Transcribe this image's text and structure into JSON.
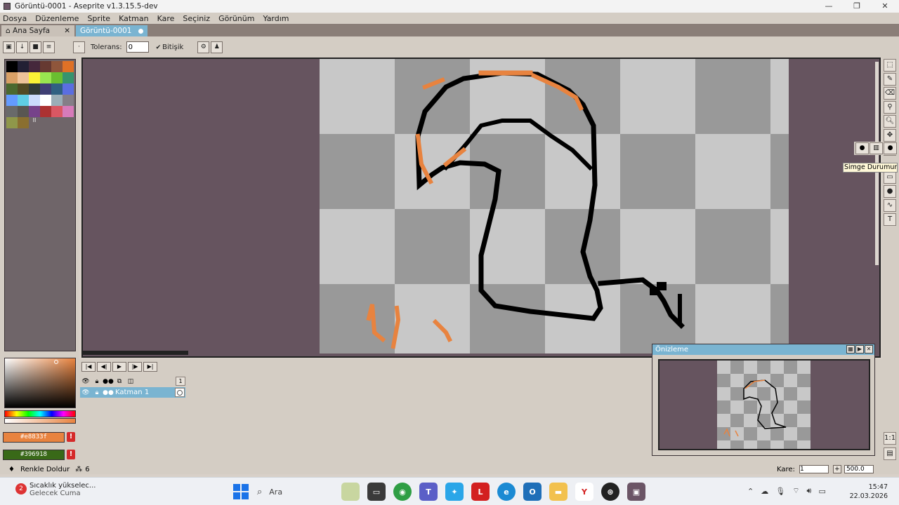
{
  "window": {
    "title": "Görüntü-0001 - Aseprite v1.3.15.5-dev",
    "minimize_icon": "minimize-icon",
    "maximize_icon": "restore-icon",
    "close_icon": "close-icon"
  },
  "menu": [
    "Dosya",
    "Düzenleme",
    "Sprite",
    "Katman",
    "Kare",
    "Seçiniz",
    "Görünüm",
    "Yardım"
  ],
  "tabs": {
    "home": "Ana Sayfa",
    "active": "Görüntü-0001"
  },
  "toolbar": {
    "tolerance_label": "Tolerans:",
    "tolerance_value": "0",
    "contiguous_label": "Bitişik"
  },
  "palette": {
    "colors": [
      "#000000",
      "#222034",
      "#45283c",
      "#663931",
      "#8f563b",
      "#df7126",
      "#d9a066",
      "#eec39a",
      "#fbf236",
      "#99e550",
      "#6abe30",
      "#37946e",
      "#4b692f",
      "#524b24",
      "#323c39",
      "#3f3f74",
      "#306082",
      "#5b6ee1",
      "#639bff",
      "#5fcde4",
      "#cbdbfc",
      "#ffffff",
      "#9badb7",
      "#847e87",
      "#696a6a",
      "#595652",
      "#76428a",
      "#ac3232",
      "#d95763",
      "#d77bba",
      "#8f974a",
      "#8a6f30"
    ],
    "extra_label": "II"
  },
  "colors": {
    "foreground": "#e8833f",
    "background": "#396918",
    "warning": "!",
    "accent": "#7ab4d1",
    "editor_bg": "#66545f"
  },
  "tooltip": "Simge Durumuna",
  "timeline": {
    "frame_number": "1",
    "layer_name": "Katman 1"
  },
  "preview": {
    "title": "Önizleme"
  },
  "status": {
    "tool_name": "Renkle Doldur",
    "tool_value": "6",
    "frame_label": "Kare:",
    "frame_value": "1",
    "zoom": "500.0"
  },
  "taskbar": {
    "weather_title": "Sıcaklık yükselec...",
    "weather_subtitle": "Gelecek Cuma",
    "weather_badge": "2",
    "search_label": "Ara",
    "time": "15:47",
    "date": "22.03.2026"
  }
}
